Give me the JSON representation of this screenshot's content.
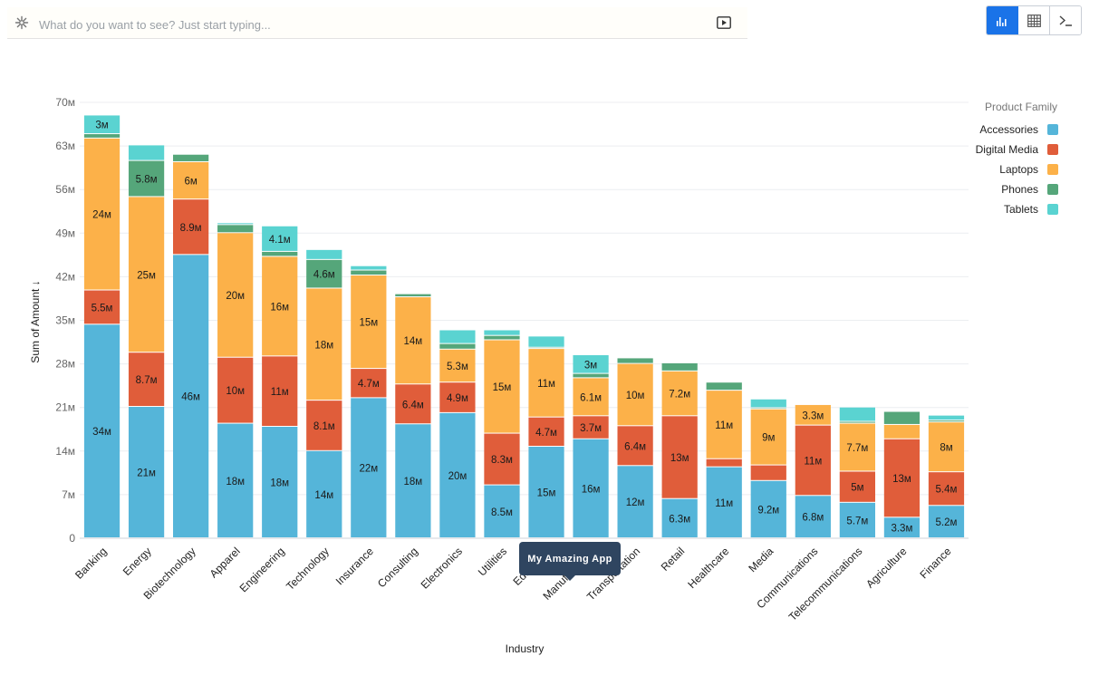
{
  "search": {
    "placeholder": "What do you want to see? Just start typing..."
  },
  "view_toggle": {
    "active": "chart",
    "options": [
      "chart-view-icon",
      "table-view-icon",
      "terminal-view-icon"
    ]
  },
  "tooltip": {
    "text": "My Amazing App"
  },
  "chart_data": {
    "type": "bar",
    "stacked": true,
    "xlabel": "Industry",
    "ylabel": "Sum of Amount ↓",
    "ylim": [
      0,
      70
    ],
    "yticks": [
      0,
      7,
      14,
      21,
      28,
      35,
      42,
      49,
      56,
      63,
      70
    ],
    "ytick_labels": [
      "0",
      "7м",
      "14м",
      "21м",
      "28м",
      "35м",
      "42м",
      "49м",
      "56м",
      "63м",
      "70м"
    ],
    "grid": true,
    "legend": {
      "title": "Product Family",
      "position": "right"
    },
    "categories": [
      "Banking",
      "Energy",
      "Biotechnology",
      "Apparel",
      "Engineering",
      "Technology",
      "Insurance",
      "Consulting",
      "Electronics",
      "Utilities",
      "Education",
      "Manufacturing",
      "Transportation",
      "Retail",
      "Healthcare",
      "Media",
      "Communications",
      "Telecommunications",
      "Agriculture",
      "Finance"
    ],
    "series": [
      {
        "name": "Accessories",
        "color": "#55b5d9",
        "values": [
          34.3,
          21.1,
          45.5,
          18.4,
          17.9,
          14.0,
          22.5,
          18.3,
          20.1,
          8.5,
          14.7,
          15.9,
          11.6,
          6.3,
          11.4,
          9.2,
          6.8,
          5.7,
          3.3,
          5.2
        ],
        "labels": [
          "34м",
          "21м",
          "46м",
          "18м",
          "18м",
          "14м",
          "22м",
          "18м",
          "20м",
          "8.5м",
          "15м",
          "16м",
          "12м",
          "6.3м",
          "11м",
          "9.2м",
          "6.8м",
          "5.7м",
          "3.3м",
          "5.2м"
        ]
      },
      {
        "name": "Digital Media",
        "color": "#e05d3a",
        "values": [
          5.5,
          8.7,
          8.9,
          10.6,
          11.3,
          8.1,
          4.7,
          6.4,
          4.9,
          8.3,
          4.7,
          3.7,
          6.4,
          13.3,
          1.3,
          2.5,
          11.3,
          5.0,
          12.6,
          5.4
        ],
        "labels": [
          "5.5м",
          "8.7м",
          "8.9м",
          "10м",
          "11м",
          "8.1м",
          "4.7м",
          "6.4м",
          "4.9м",
          "8.3м",
          "4.7м",
          "3.7м",
          "6.4м",
          "13м",
          "",
          "",
          "11м",
          "5м",
          "13м",
          "5.4м"
        ]
      },
      {
        "name": "Laptops",
        "color": "#fcb149",
        "values": [
          24.4,
          25.0,
          6.0,
          20.0,
          16.0,
          18.0,
          15.0,
          14.0,
          5.3,
          15.0,
          11.0,
          6.1,
          10.0,
          7.2,
          11.0,
          9.0,
          3.3,
          7.7,
          2.3,
          8.0
        ],
        "labels": [
          "24м",
          "25м",
          "6м",
          "20м",
          "16м",
          "18м",
          "15м",
          "14м",
          "5.3м",
          "15м",
          "11м",
          "6.1м",
          "10м",
          "7.2м",
          "11м",
          "9м",
          "3.3м",
          "7.7м",
          "",
          "8м"
        ]
      },
      {
        "name": "Phones",
        "color": "#55a67a",
        "values": [
          0.7,
          5.8,
          1.2,
          1.3,
          0.8,
          4.6,
          0.8,
          0.5,
          0.9,
          0.7,
          0.2,
          0.7,
          0.9,
          1.3,
          1.3,
          0.2,
          0.1,
          0.3,
          2.1,
          0.3
        ],
        "labels": [
          "",
          "5.8м",
          "",
          "",
          "",
          "4.6м",
          "",
          "",
          "",
          "",
          "",
          "",
          "",
          "",
          "",
          "",
          "",
          "",
          "",
          ""
        ]
      },
      {
        "name": "Tablets",
        "color": "#5ad3d1",
        "values": [
          3.0,
          2.5,
          0.1,
          0.3,
          4.1,
          1.6,
          0.7,
          0.1,
          2.2,
          0.9,
          1.8,
          3.0,
          0.1,
          0.1,
          0.1,
          1.4,
          0.1,
          2.3,
          0.1,
          0.8
        ],
        "labels": [
          "3м",
          "",
          "",
          "",
          "4.1м",
          "",
          "",
          "",
          "",
          "",
          "",
          "3м",
          "",
          "",
          "",
          "",
          "",
          "",
          "",
          ""
        ]
      }
    ]
  }
}
